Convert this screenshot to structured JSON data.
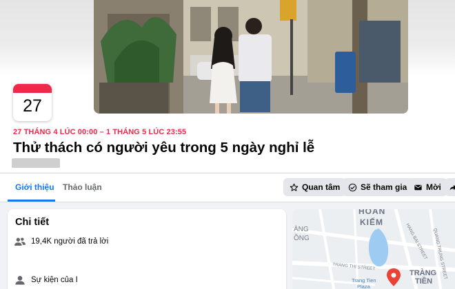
{
  "event": {
    "calendar_day": "27",
    "date_range": "27 THÁNG 4 LÚC 00:00 – 1 THÁNG 5 LÚC 23:55",
    "title": "Thử thách có người yêu trong 5 ngày nghỉ lễ"
  },
  "tabs": [
    {
      "label": "Giới thiệu",
      "active": true
    },
    {
      "label": "Thảo luận",
      "active": false
    }
  ],
  "actions": {
    "interested": "Quan tâm",
    "going": "Sẽ tham gia",
    "invite": "Mời"
  },
  "details": {
    "heading": "Chi tiết",
    "responses": "19,4K người đã trả lời",
    "event_by": "Sự kiện của I"
  },
  "map": {
    "labels": {
      "district_a": "HOÀN",
      "district_b": "KIẾM",
      "area_left": "ÀNG",
      "area_left2": "ỒNG",
      "street_trang_thi": "TRANG THI STREET",
      "street_hang_bai": "HANG BAI STREET",
      "street_quang_trung": "QUANG TRUNG STREET",
      "place": "TRANG TIEN PLAZA",
      "place_short": "Trang Tien",
      "place_short2": "Plaza",
      "area_right_1": "TRÀNG",
      "area_right_2": "TIỀN"
    }
  },
  "colors": {
    "accent": "#1877f2",
    "event_red": "#f02849",
    "button_bg": "#e4e6eb"
  }
}
